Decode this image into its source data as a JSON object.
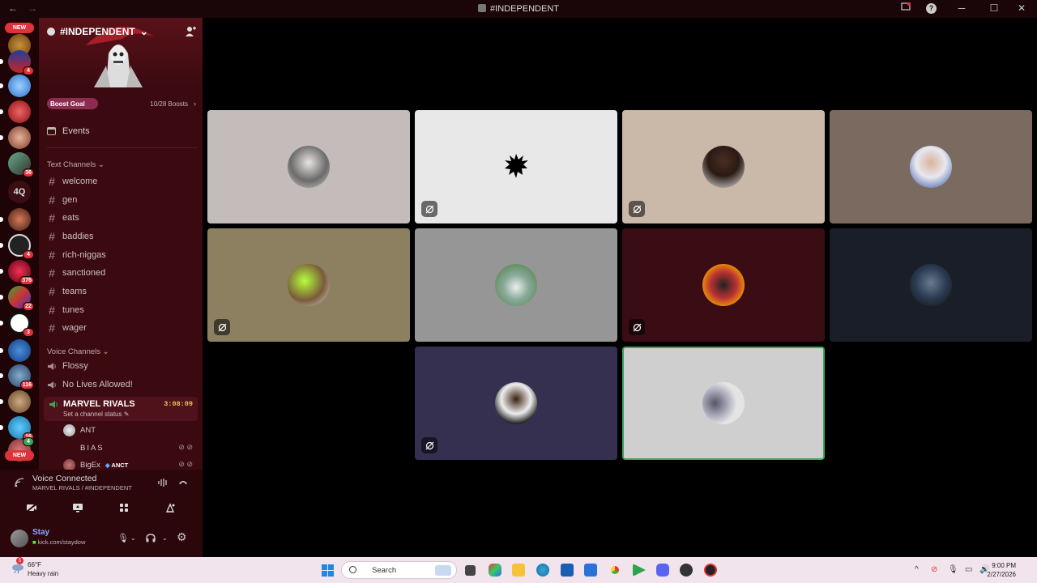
{
  "window": {
    "title": "#INDEPENDENT",
    "back": "←",
    "forward": "→",
    "help": "?",
    "minimize": "─",
    "maximize": "☐",
    "close": "✕"
  },
  "servers": {
    "new_top": "NEW",
    "new_bottom": "NEW",
    "text_server": "4Q",
    "badges": [
      "4",
      "36",
      "4",
      "376",
      "22",
      "3",
      "116",
      "16",
      "4"
    ]
  },
  "sidebar": {
    "server_name": "#INDEPENDENT",
    "boost_label": "Boost Goal",
    "boost_count": "10/28 Boosts",
    "boost_progress": 0.357,
    "events": "Events",
    "text_category": "Text Channels",
    "text_channels": [
      "welcome",
      "gen",
      "eats",
      "baddies",
      "rich-niggas",
      "sanctioned",
      "teams",
      "tunes",
      "wager"
    ],
    "voice_category": "Voice Channels",
    "voice_channels": [
      "Flossy",
      "No Lives Allowed!"
    ],
    "active_channel": {
      "name": "MARVEL RIVALS",
      "time": "3:08:09",
      "status": "Set a channel status"
    },
    "members": [
      {
        "name": "ANT"
      },
      {
        "name": "BIAS"
      },
      {
        "name": "BigEx",
        "tag": "ANCT"
      }
    ]
  },
  "voice": {
    "status": "Voice Connected",
    "channel": "MARVEL RIVALS / #INDEPENDENT"
  },
  "user": {
    "name": "Stay",
    "status": "kick.com/staydow"
  },
  "colors": {
    "accent_green": "#3ba55c",
    "badge_red": "#e0323a",
    "sidebar_bg": "#3a0a10",
    "timer_yellow": "#e6c35c"
  },
  "taskbar": {
    "temp": "66°F",
    "weather": "Heavy rain",
    "weather_badge": "5",
    "search_placeholder": "Search",
    "time": "9:00 PM",
    "date": "2/27/2026"
  }
}
